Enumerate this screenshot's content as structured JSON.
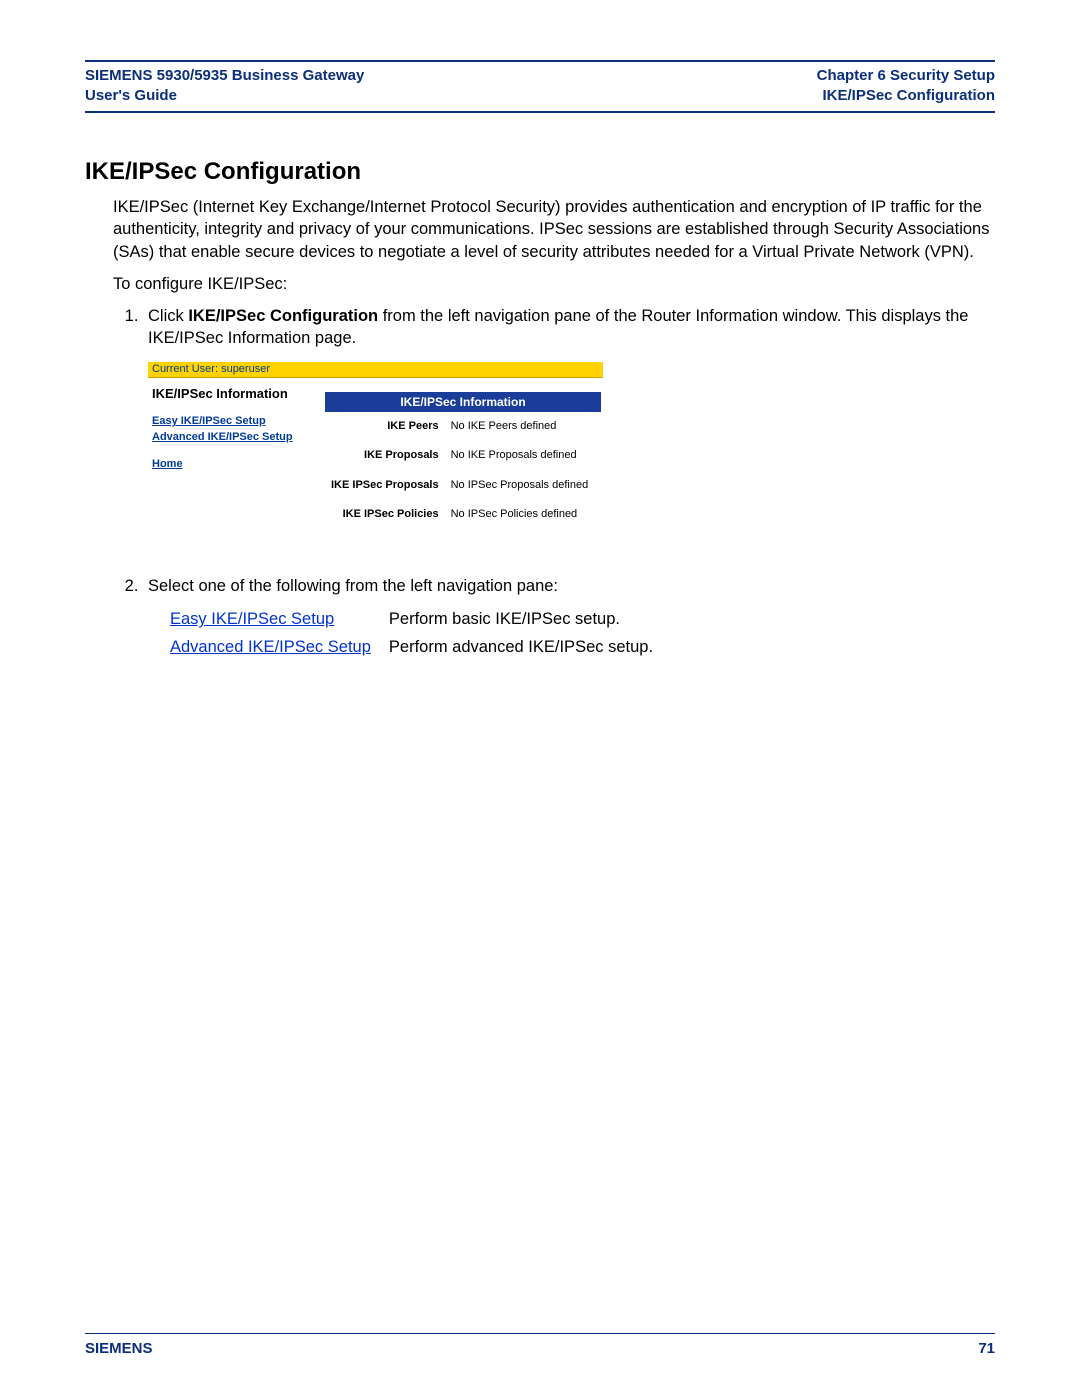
{
  "header": {
    "left_line1": "SIEMENS 5930/5935 Business Gateway",
    "left_line2": "User's Guide",
    "right_line1": "Chapter 6  Security Setup",
    "right_line2": "IKE/IPSec Configuration"
  },
  "title": "IKE/IPSec Configuration",
  "intro_paragraph": "IKE/IPSec (Internet Key Exchange/Internet Protocol Security) provides authentication and encryption of IP traffic for the authenticity, integrity and privacy of your communications. IPSec sessions are established through Security Associations (SAs) that enable secure devices to negotiate a level of security attributes needed for a Virtual Private Network (VPN).",
  "configure_lead": "To configure IKE/IPSec:",
  "step1": {
    "prefix": "Click ",
    "bold_text": "IKE/IPSec Configuration",
    "suffix": " from the left navigation pane of the Router Information window. This displays the IKE/IPSec Information page."
  },
  "embed": {
    "current_user": "Current User: superuser",
    "left_title": "IKE/IPSec Information",
    "links": {
      "easy": "Easy IKE/IPSec Setup",
      "advanced": "Advanced IKE/IPSec Setup",
      "home": "Home"
    },
    "table_title": "IKE/IPSec Information",
    "rows": [
      {
        "label": "IKE Peers",
        "value": "No IKE Peers defined"
      },
      {
        "label": "IKE Proposals",
        "value": "No IKE Proposals defined"
      },
      {
        "label": "IKE IPSec Proposals",
        "value": "No IPSec Proposals defined"
      },
      {
        "label": "IKE IPSec Policies",
        "value": "No IPSec Policies defined"
      }
    ]
  },
  "step2_text": "Select one of the following from the left navigation pane:",
  "options": [
    {
      "link": "Easy IKE/IPSec Setup",
      "desc": "Perform basic IKE/IPSec setup."
    },
    {
      "link": "Advanced IKE/IPSec Setup",
      "desc": "Perform advanced IKE/IPSec setup."
    }
  ],
  "footer": {
    "brand": "SIEMENS",
    "page_number": "71"
  }
}
